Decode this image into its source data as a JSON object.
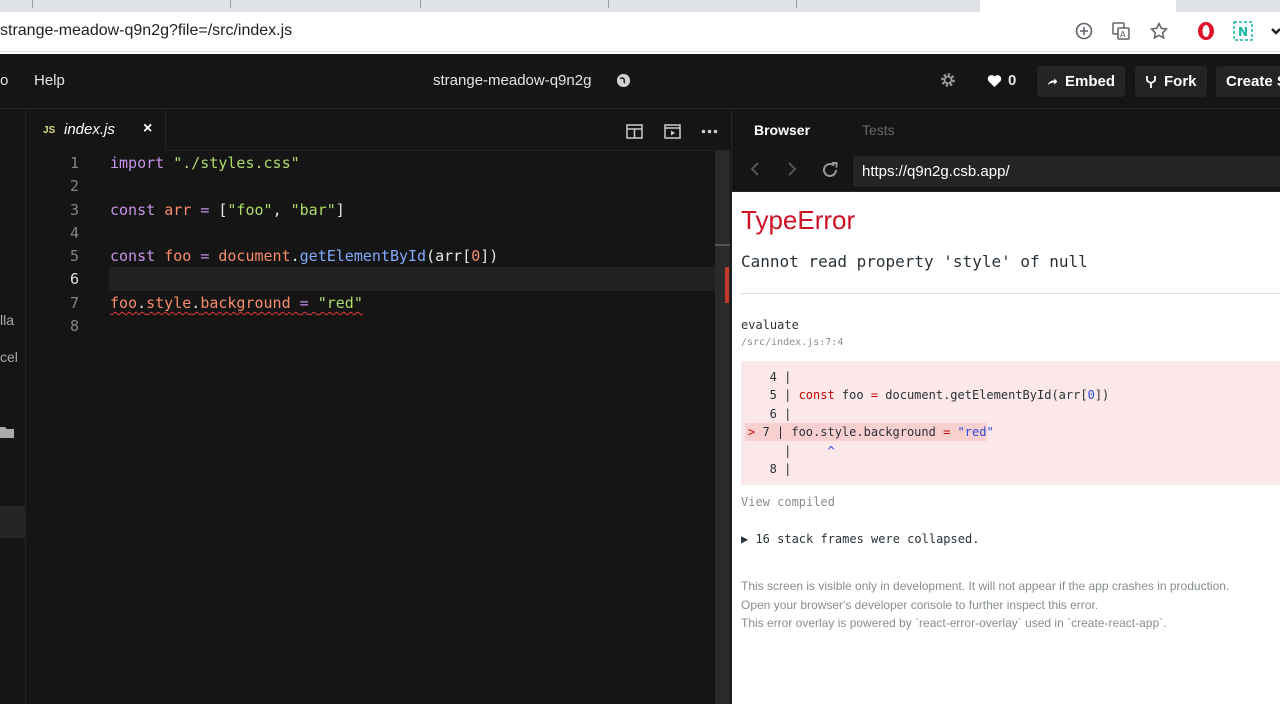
{
  "browser": {
    "url": "strange-meadow-q9n2g?file=/src/index.js",
    "extensions": [
      "add-icon",
      "translate-icon",
      "star-icon",
      "opera-icon",
      "notion-icon",
      "chevron-icon"
    ]
  },
  "header": {
    "menu_fragment": "o",
    "help_label": "Help",
    "sandbox_title": "strange-meadow-q9n2g",
    "likes_count": "0",
    "embed_label": "Embed",
    "fork_label": "Fork",
    "create_label": "Create S"
  },
  "sidebar": {
    "fragments": [
      "lla",
      "cel"
    ]
  },
  "editor": {
    "tab_badge": "JS",
    "tab_filename": "index.js",
    "tab_close": "×",
    "line_numbers": [
      "1",
      "2",
      "3",
      "4",
      "5",
      "6",
      "7",
      "8"
    ],
    "current_line": "6"
  },
  "preview": {
    "tab_browser": "Browser",
    "tab_tests": "Tests",
    "address": "https://q9n2g.csb.app/",
    "error": {
      "title": "TypeError",
      "message": "Cannot read property 'style' of null",
      "evaluate_label": "evaluate",
      "location": "/src/index.js:7:4",
      "view_compiled": "View compiled",
      "collapsed_frames": "▶ 16 stack frames were collapsed.",
      "footnotes": [
        "This screen is visible only in development. It will not appear if the app crashes in production.",
        "Open your browser's developer console to further inspect this error.",
        "This error overlay is powered by `react-error-overlay` used in `create-react-app`."
      ]
    }
  },
  "colors": {
    "error_red": "#ce1126",
    "editor_bg": "#151515",
    "keyword": "#c792ea",
    "string": "#addb67"
  }
}
